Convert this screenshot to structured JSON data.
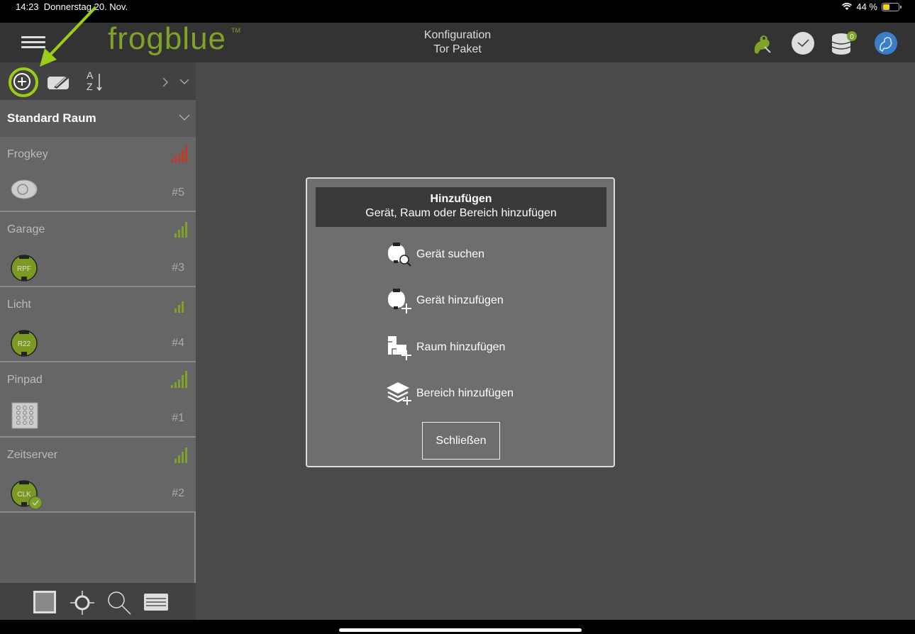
{
  "status": {
    "time": "14:23",
    "date": "Donnerstag 20. Nov.",
    "battery": "44 %",
    "battery_level": 0.44
  },
  "header": {
    "logo": "frogblue",
    "logo_tm": "TM",
    "title": "Konfiguration",
    "subtitle": "Tor Paket",
    "db_badge": "0"
  },
  "sidebar": {
    "room": "Standard Raum",
    "devices": [
      {
        "name": "Frogkey",
        "number": "#5",
        "icon": "frogkey-icon",
        "signal_color": "#c0392b"
      },
      {
        "name": "Garage",
        "number": "#3",
        "icon_label": "RPF",
        "signal_color": "#7fa328"
      },
      {
        "name": "Licht",
        "number": "#4",
        "icon_label": "R22",
        "signal_color": "#7fa328"
      },
      {
        "name": "Pinpad",
        "number": "#1",
        "icon": "pinpad-icon",
        "signal_color": "#7fa328"
      },
      {
        "name": "Zeitserver",
        "number": "#2",
        "icon_label": "CLK",
        "signal_color": "#7fa328"
      }
    ]
  },
  "dialog": {
    "title": "Hinzufügen",
    "subtitle": "Gerät, Raum oder Bereich hinzufügen",
    "items": [
      {
        "label": "Gerät suchen"
      },
      {
        "label": "Gerät hinzufügen"
      },
      {
        "label": "Raum hinzufügen"
      },
      {
        "label": "Bereich hinzufügen"
      }
    ],
    "close": "Schließen"
  },
  "colors": {
    "accent": "#7fa328",
    "highlight": "#9acd1a"
  }
}
